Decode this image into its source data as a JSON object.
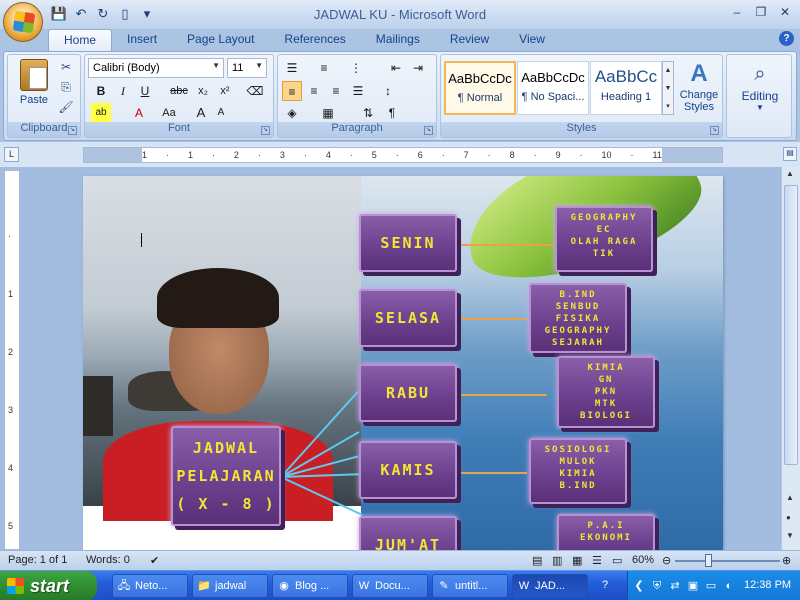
{
  "window": {
    "title": "JADWAL KU - Microsoft Word"
  },
  "tabs": [
    "Home",
    "Insert",
    "Page Layout",
    "References",
    "Mailings",
    "Review",
    "View"
  ],
  "ribbon": {
    "clipboard": {
      "label": "Clipboard",
      "paste": "Paste"
    },
    "font": {
      "label": "Font",
      "font_name": "Calibri (Body)",
      "font_size": "11"
    },
    "paragraph": {
      "label": "Paragraph"
    },
    "styles": {
      "label": "Styles",
      "items": [
        {
          "sample": "AaBbCcDc",
          "name": "¶ Normal"
        },
        {
          "sample": "AaBbCcDc",
          "name": "¶ No Spaci..."
        },
        {
          "sample": "AaBbCc",
          "name": "Heading 1"
        }
      ],
      "change_styles": "Change Styles"
    },
    "editing": {
      "label": "Editing"
    }
  },
  "ruler": {
    "ticks": [
      "1",
      "·",
      "1",
      "·",
      "2",
      "·",
      "3",
      "·",
      "4",
      "·",
      "5",
      "·",
      "6",
      "·",
      "7",
      "·",
      "8",
      "·",
      "9",
      "·",
      "10",
      "·",
      "11"
    ]
  },
  "document": {
    "main_box": [
      "JADWAL",
      "PELAJARAN",
      "( X - 8 )"
    ],
    "days": [
      "SENIN",
      "SELASA",
      "RABU",
      "KAMIS",
      "JUM'AT"
    ],
    "subjects": [
      [
        "GEOGRAPHY",
        "EC",
        "OLAH RAGA",
        "TIK"
      ],
      [
        "B.IND",
        "SENBUD",
        "FISIKA",
        "GEOGRAPHY",
        "SEJARAH"
      ],
      [
        "KIMIA",
        "GN",
        "PKN",
        "MTK",
        "BIOLOGI"
      ],
      [
        "SOSIOLOGI",
        "MULOK",
        "KIMIA",
        "B.IND"
      ],
      [
        "P.A.I",
        "EKONOMI"
      ]
    ]
  },
  "statusbar": {
    "page": "Page: 1 of 1",
    "words": "Words: 0",
    "zoom": "60%"
  },
  "taskbar": {
    "start": "start",
    "tasks": [
      "Neto...",
      "jadwal",
      "Blog ...",
      "Docu...",
      "untitl...",
      "JAD..."
    ],
    "clock": "12:38 PM"
  }
}
